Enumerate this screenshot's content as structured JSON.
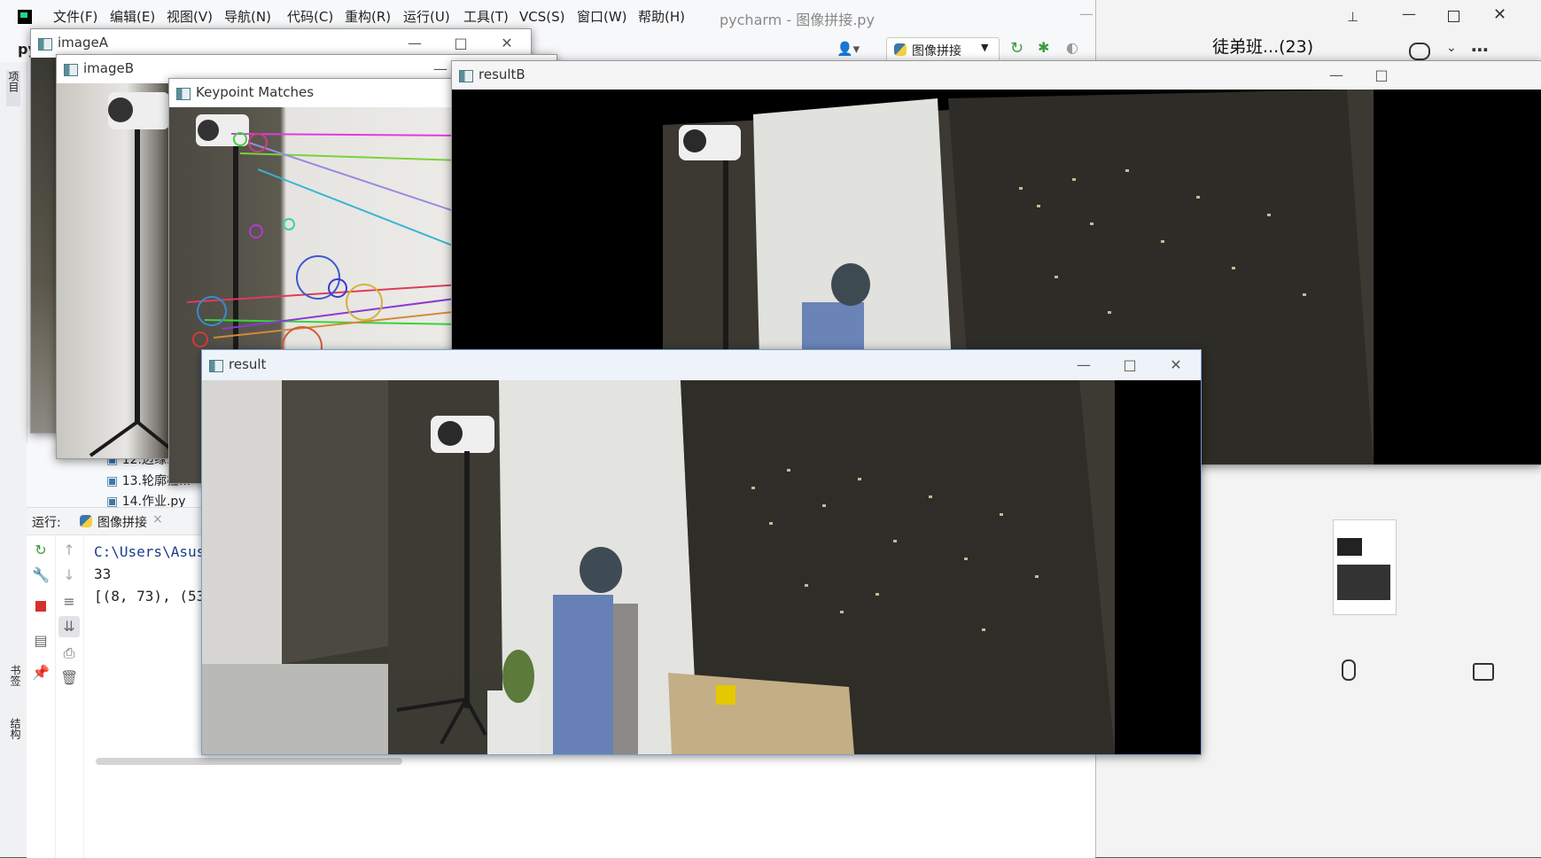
{
  "ide": {
    "app_short": "py",
    "title": "pycharm - 图像拼接.py",
    "menu": [
      "文件(F)",
      "编辑(E)",
      "视图(V)",
      "导航(N)",
      "代码(C)",
      "重构(R)",
      "运行(U)",
      "工具(T)",
      "VCS(S)",
      "窗口(W)",
      "帮助(H)"
    ],
    "run_config": "图像拼接",
    "project_tab": "项目",
    "bookmarks_tab": "书签",
    "structure_tab": "结构",
    "files": [
      "12.边缘...",
      "13.轮廓检...",
      "14.作业.py"
    ],
    "run_label": "运行:",
    "run_tab": "图像拼接",
    "console": [
      "C:\\Users\\Asus\\",
      "33",
      "[(8, 73), (53"
    ]
  },
  "chat": {
    "title": "徒弟班...(23)"
  },
  "windows": {
    "imageA": "imageA",
    "imageB": "imageB",
    "matches": "Keypoint Matches",
    "resultB": "resultB",
    "result": "result"
  }
}
